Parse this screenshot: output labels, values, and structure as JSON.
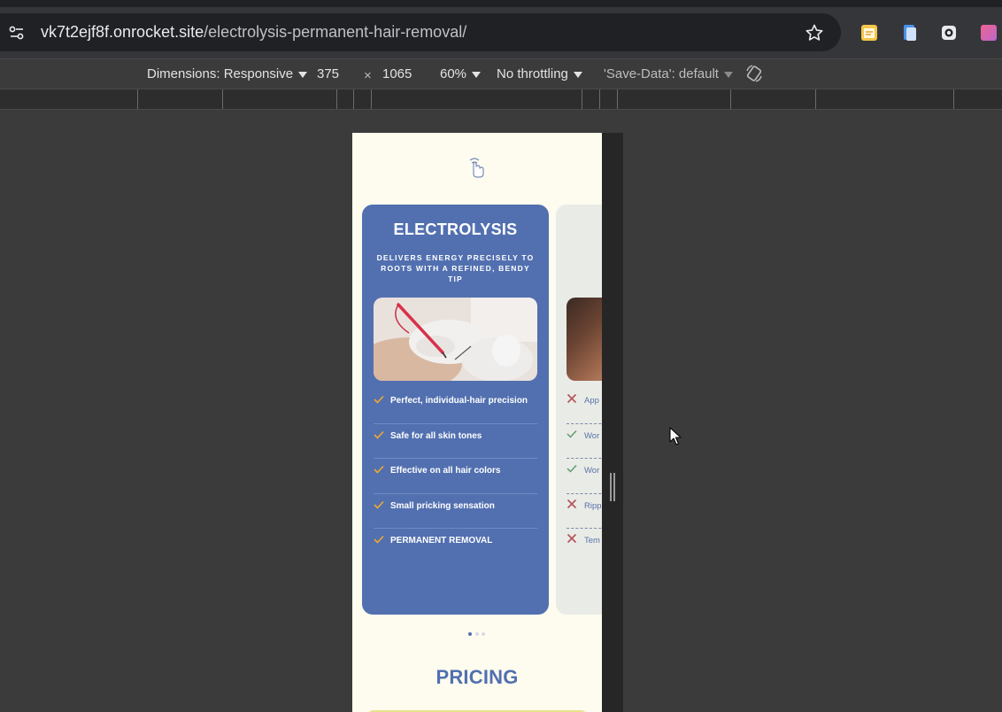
{
  "browser": {
    "url_host": "vk7t2ejf8f.onrocket.site",
    "url_path": "/electrolysis-permanent-hair-removal/"
  },
  "devtools": {
    "dimensions_label": "Dimensions: Responsive",
    "width": "375",
    "times": "×",
    "height": "1065",
    "zoom": "60%",
    "throttling": "No throttling",
    "save_data": "'Save-Data': default"
  },
  "page": {
    "card": {
      "title": "ELECTROLYSIS",
      "subtitle": "DELIVERS ENERGY PRECISELY TO ROOTS WITH A REFINED, BENDY TIP",
      "features": [
        "Perfect, individual-hair precision",
        "Safe for all skin tones",
        "Effective on all hair colors",
        "Small pricking sensation",
        "PERMANENT REMOVAL"
      ]
    },
    "card2": {
      "rows": [
        {
          "mark": "cross",
          "text": "App"
        },
        {
          "mark": "check",
          "text": "Wor"
        },
        {
          "mark": "check",
          "text": "Wor"
        },
        {
          "mark": "cross",
          "text": "Ripp"
        },
        {
          "mark": "cross",
          "text": "Tem"
        }
      ]
    },
    "carousel_active": 1,
    "pricing_heading": "PRICING"
  },
  "colors": {
    "card_blue": "#5270b0",
    "cream_bg": "#fdfcef",
    "check_orange": "#f0a830",
    "cross_red": "#b5525a",
    "check_green": "#5a9a6a"
  }
}
